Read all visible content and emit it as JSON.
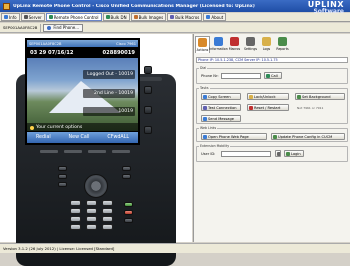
{
  "window": {
    "title": "UpLinx Remote Phone Control - Cisco Unified Communications Manager (Licensed to: UpLinx)",
    "brand_line1": "UPLINX",
    "brand_line2": "Software"
  },
  "toolbar": {
    "items": [
      "Info",
      "Server",
      "Remote Phone Control",
      "Bulk DN",
      "Bulk Images",
      "Bulk Macros",
      "About"
    ]
  },
  "devicebar": {
    "device_name": "SEP001AA0F8C2B",
    "find_label": "Find Phone..."
  },
  "phone_screen": {
    "header_left": "SEP001AA0F8C2B",
    "header_right": "Cisco 7961",
    "datetime": "03 29 07/16/12",
    "extension": "028890019",
    "line1": "Logged Out - 10019",
    "line2": "2nd Line - 10019",
    "line3": "10019",
    "status": "Your current options",
    "softkeys": [
      "Redial",
      "New Call",
      "CFwdALL"
    ]
  },
  "panel": {
    "tabs": [
      "Actions",
      "Information",
      "Macros",
      "Settings",
      "Logs",
      "Reports"
    ],
    "device_info": "Phone IP: 10.5.1.238, CCM Server IP: 10.5.1.75",
    "dial": {
      "group": "Dial",
      "phone_label": "Phone Nr:",
      "phone_value": "",
      "call_button": "Call"
    },
    "tasks": {
      "group": "Tasks",
      "buttons": [
        "Copy Screen",
        "Lock/Unlock",
        "Set Background",
        "Test Connection",
        "Reset / Restart",
        "Send Message"
      ],
      "note": "Not 7961 or 7911"
    },
    "web": {
      "group": "Web Links",
      "buttons": [
        "Open Phone Web Page",
        "Update Phone Config in CUCM"
      ]
    },
    "ext": {
      "group": "Extension Mobility",
      "user_label": "User ID:",
      "user_value": "",
      "login_button": "Login"
    }
  },
  "statusbar": {
    "text": "Version 3.1.2 (26 July 2012) | License: Licensed [Standard]"
  },
  "colors": {
    "title_blue": "#1f4ea6",
    "softkey_blue": "#3466b0",
    "phone_body": "#1c1f23"
  }
}
